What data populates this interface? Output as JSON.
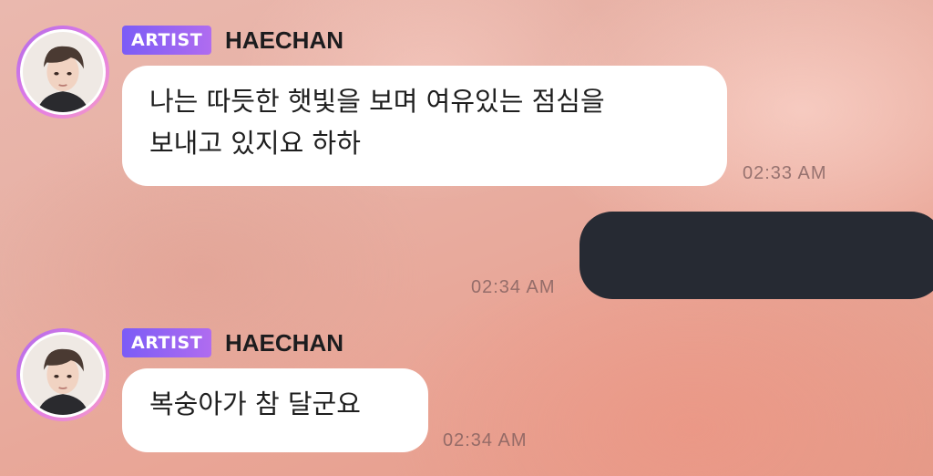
{
  "messages": [
    {
      "sender": "HAECHAN",
      "badge": "ARTIST",
      "text_line1": "나는 따듯한 햇빛을 보며 여유있는 점심을",
      "text_line2": "보내고 있지요 하하",
      "time": "02:33 AM"
    },
    {
      "sender": "",
      "text": "",
      "time": "02:34 AM"
    },
    {
      "sender": "HAECHAN",
      "badge": "ARTIST",
      "text": "복숭아가 참 달군요",
      "time": "02:34 AM"
    }
  ],
  "colors": {
    "badge_start": "#7b5cf6",
    "badge_end": "#b06cf0",
    "my_bubble": "#262a33",
    "artist_bubble": "#ffffff"
  },
  "icons": [
    "avatar-photo"
  ]
}
